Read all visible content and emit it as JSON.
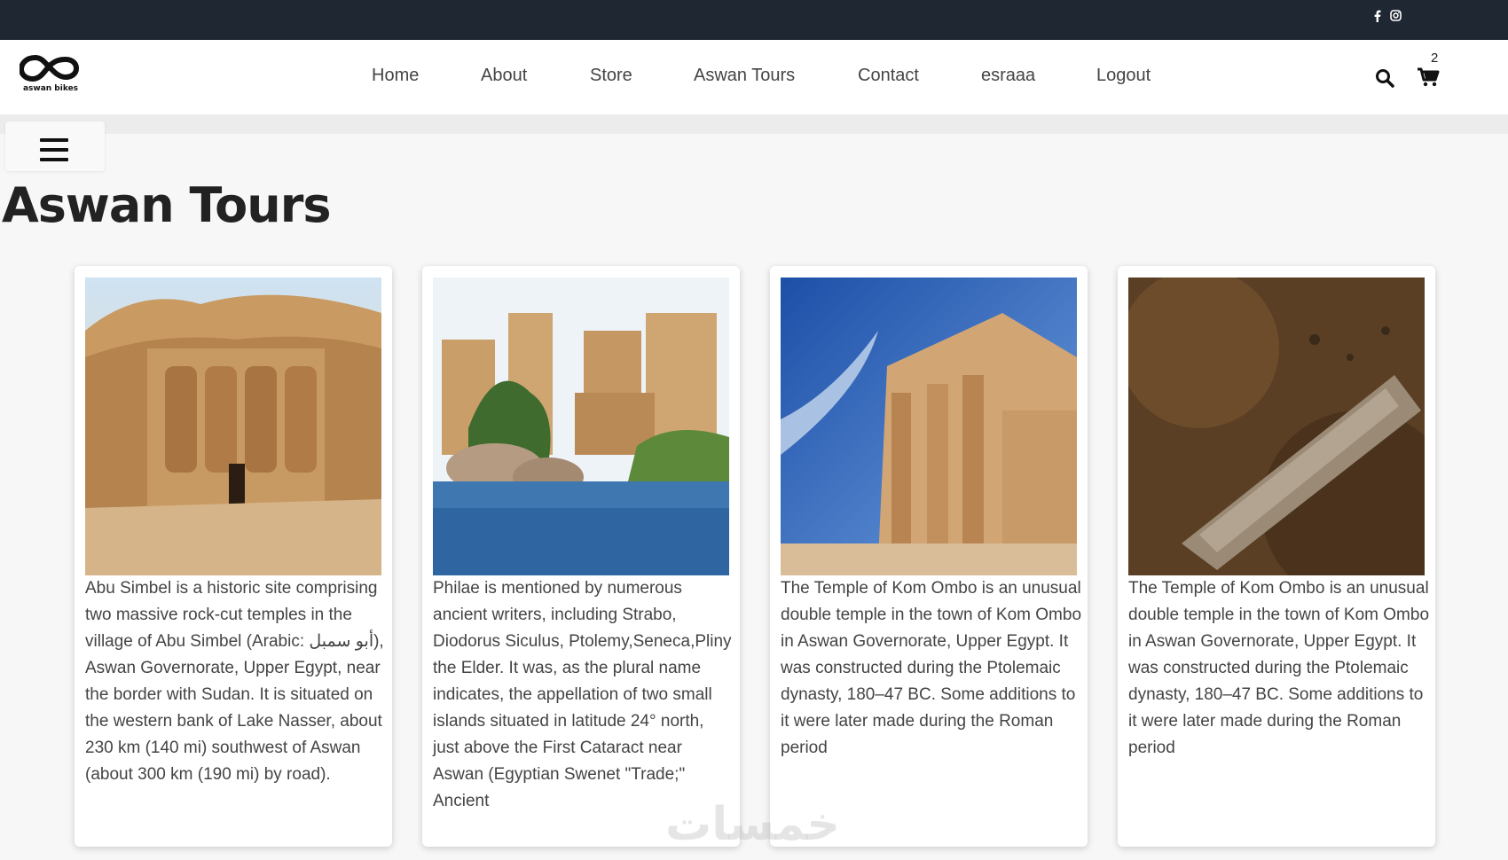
{
  "brand": {
    "logo_text": "aswan bikes"
  },
  "nav": {
    "items": [
      {
        "label": "Home"
      },
      {
        "label": "About"
      },
      {
        "label": "Store"
      },
      {
        "label": "Aswan Tours"
      },
      {
        "label": "Contact"
      },
      {
        "label": "esraaa"
      },
      {
        "label": "Logout"
      }
    ]
  },
  "social": {
    "icons": [
      "facebook-icon",
      "instagram-icon"
    ]
  },
  "cart": {
    "count": "2"
  },
  "page": {
    "title": "Aswan Tours"
  },
  "cards": [
    {
      "image": "abu-simbel-temple",
      "description": "Abu Simbel is a historic site comprising two massive rock-cut temples in the village of Abu Simbel (Arabic: أبو سمبل), Aswan Governorate, Upper Egypt, near the border with Sudan. It is situated on the western bank of Lake Nasser, about 230 km (140 mi) southwest of Aswan (about 300 km (190 mi) by road)."
    },
    {
      "image": "philae-temple",
      "description": "Philae is mentioned by numerous ancient writers, including Strabo, Diodorus Siculus, Ptolemy,Seneca,Pliny the Elder. It was, as the plural name indicates, the appellation of two small islands situated in latitude 24° north, just above the First Cataract near Aswan (Egyptian Swenet \"Trade;\" Ancient"
    },
    {
      "image": "kom-ombo-temple",
      "description": "The Temple of Kom Ombo is an unusual double temple in the town of Kom Ombo in Aswan Governorate, Upper Egypt. It was constructed during the Ptolemaic dynasty, 180–47 BC. Some additions to it were later made during the Roman period"
    },
    {
      "image": "unfinished-obelisk",
      "description": "The Temple of Kom Ombo is an unusual double temple in the town of Kom Ombo in Aswan Governorate, Upper Egypt. It was constructed during the Ptolemaic dynasty, 180–47 BC. Some additions to it were later made during the Roman period"
    }
  ],
  "watermark": "خمسات"
}
